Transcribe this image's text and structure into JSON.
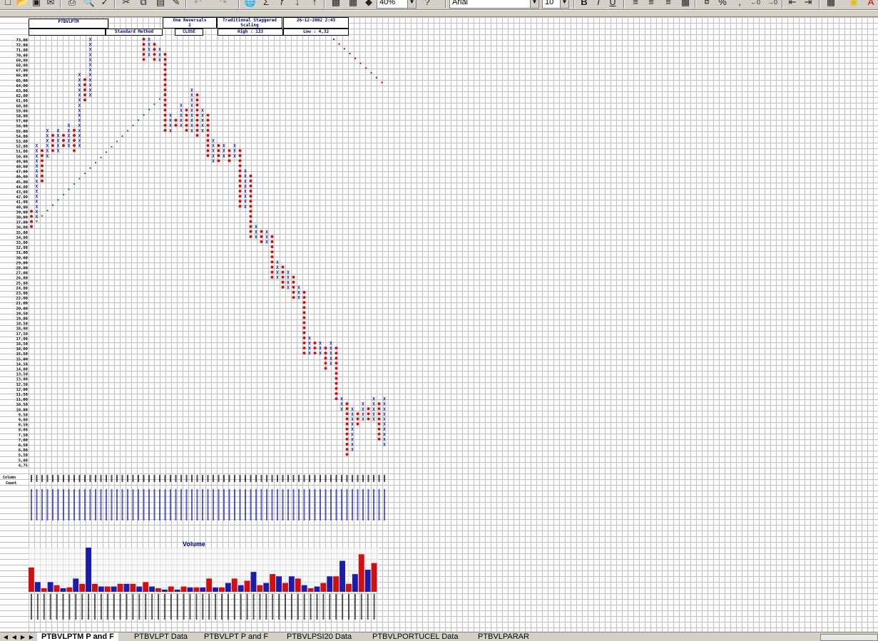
{
  "toolbar": {
    "zoom": "40%",
    "font_name": "Arial",
    "font_size": "10",
    "bold_label": "B",
    "italic_label": "I",
    "underline_label": "U",
    "percent_label": "%",
    "comma_label": ","
  },
  "header_boxes": {
    "ticker": "PTBVLPTM",
    "reversal": "One Reversals",
    "reversal_n": "2",
    "scaling": "Traditional Staggered Scaling",
    "datetime": "26-12-2002 2:43",
    "method": "Standard Method",
    "price_field": "CLOSE",
    "high": "High : 133",
    "low": "Low : 4,32"
  },
  "y_labels": [
    "73,00",
    "72,00",
    "71,00",
    "70,00",
    "69,00",
    "68,00",
    "67,00",
    "66,00",
    "65,00",
    "64,00",
    "63,00",
    "62,00",
    "61,00",
    "60,00",
    "59,00",
    "58,00",
    "57,00",
    "56,00",
    "55,00",
    "54,00",
    "53,00",
    "52,00",
    "51,00",
    "50,00",
    "49,00",
    "48,00",
    "47,00",
    "46,00",
    "45,00",
    "44,00",
    "43,00",
    "42,00",
    "41,00",
    "40,00",
    "39,00",
    "38,00",
    "37,00",
    "36,00",
    "35,00",
    "34,00",
    "33,00",
    "32,00",
    "31,00",
    "30,00",
    "29,00",
    "28,00",
    "27,00",
    "26,00",
    "25,00",
    "24,00",
    "23,00",
    "22,00",
    "21,00",
    "20,00",
    "19,50",
    "19,00",
    "18,50",
    "18,00",
    "17,50",
    "17,00",
    "16,50",
    "16,00",
    "15,50",
    "15,00",
    "14,50",
    "14,00",
    "13,50",
    "13,00",
    "12,50",
    "12,00",
    "11,50",
    "11,00",
    "10,50",
    "10,00",
    "9,50",
    "9,00",
    "8,50",
    "8,00",
    "7,50",
    "7,00",
    "6,50",
    "6,00",
    "5,50",
    "5,00",
    "4,75"
  ],
  "column_label": "Column",
  "count_label": "Count",
  "volume_title": "Volume",
  "sheet_tabs": [
    {
      "label": "PTBVLPTM P and F",
      "active": true
    },
    {
      "label": "PTBVLPT Data",
      "active": false
    },
    {
      "label": "PTBVLPT P and F",
      "active": false
    },
    {
      "label": "PTBVLPSI20 Data",
      "active": false
    },
    {
      "label": "PTBVLPORTUCEL Data",
      "active": false
    },
    {
      "label": "PTBVLPARAR",
      "active": false
    }
  ],
  "colors": {
    "x_mark": "#1c1ca8",
    "o_mark": "#d01010",
    "trend": "#1a8a1a",
    "vol_up": "#1c1ca8",
    "vol_down": "#d01010"
  }
}
